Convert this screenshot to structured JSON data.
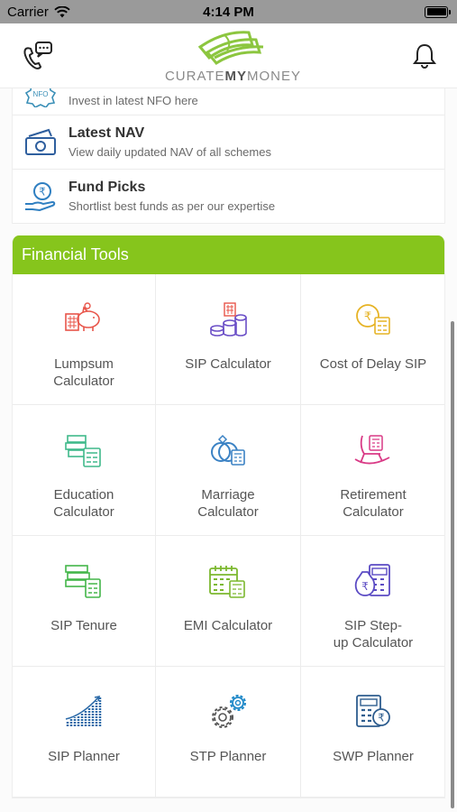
{
  "status_bar": {
    "carrier": "Carrier",
    "time": "4:14 PM"
  },
  "header": {
    "logo_prefix": "CURATE",
    "logo_bold": "MY",
    "logo_suffix": "MONEY"
  },
  "menu": [
    {
      "icon": "nfo-icon",
      "icon_text": "NFO",
      "title": "",
      "subtitle": "Invest in latest NFO here"
    },
    {
      "icon": "cash-icon",
      "title": "Latest NAV",
      "subtitle": "View daily updated NAV of all schemes"
    },
    {
      "icon": "rupee-hand-icon",
      "title": "Fund Picks",
      "subtitle": "Shortlist best funds as per our expertise"
    }
  ],
  "tools": {
    "title": "Financial Tools",
    "items": [
      {
        "label": "Lumpsum\nCalculator",
        "icon": "piggy-bank-icon"
      },
      {
        "label": "SIP Calculator",
        "icon": "coins-stack-icon"
      },
      {
        "label": "Cost of Delay SIP",
        "icon": "rupee-coin-calculator-icon"
      },
      {
        "label": "Education\nCalculator",
        "icon": "books-calculator-icon"
      },
      {
        "label": "Marriage\nCalculator",
        "icon": "rings-calculator-icon"
      },
      {
        "label": "Retirement\nCalculator",
        "icon": "rocking-chair-icon"
      },
      {
        "label": "SIP Tenure",
        "icon": "book-stack-calculator-icon"
      },
      {
        "label": "EMI Calculator",
        "icon": "calendar-calculator-icon"
      },
      {
        "label": "SIP Step-\nup Calculator",
        "icon": "money-bag-calculator-icon"
      },
      {
        "label": "SIP Planner",
        "icon": "growth-bars-icon"
      },
      {
        "label": "STP Planner",
        "icon": "gears-icon"
      },
      {
        "label": "SWP Planner",
        "icon": "calculator-rupee-icon"
      }
    ]
  },
  "colors": {
    "accent": "#86c51c",
    "status_bar": "#9a9a9a"
  }
}
